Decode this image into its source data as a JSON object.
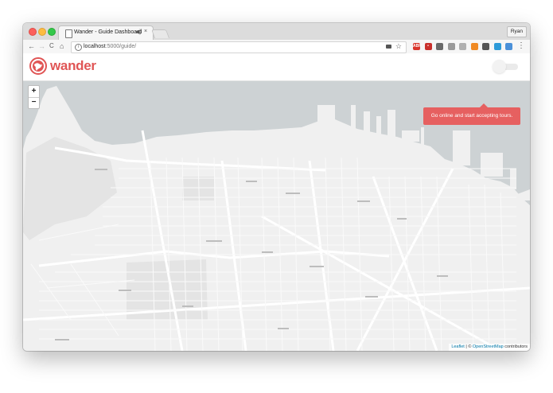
{
  "browser": {
    "tab_title": "Wander - Guide Dashboard",
    "tab_audio_icon": "speaker-icon",
    "tab_close_glyph": "×",
    "profile_name": "Ryan",
    "url_host": "localhost",
    "url_rest": ":5000/guide/",
    "nav": {
      "back": "←",
      "forward": "→",
      "reload": "C",
      "home": "⌂"
    },
    "extensions": [
      {
        "name": "adblock-icon",
        "color": "#d9342b",
        "glyph": "ABP"
      },
      {
        "name": "lastpass-icon",
        "color": "#c9302c",
        "glyph": "•"
      },
      {
        "name": "ghostery-icon",
        "color": "#6a6a6a",
        "glyph": ""
      },
      {
        "name": "camera-icon",
        "color": "#9a9a9a",
        "glyph": ""
      },
      {
        "name": "gray-extension-icon",
        "color": "#b0b0b0",
        "glyph": ""
      },
      {
        "name": "rss-icon",
        "color": "#f08a24",
        "glyph": ""
      },
      {
        "name": "dark-extension-icon",
        "color": "#555555",
        "glyph": ""
      },
      {
        "name": "twitter-icon",
        "color": "#2d9bd9",
        "glyph": ""
      },
      {
        "name": "blue-extension-icon",
        "color": "#4a90d9",
        "glyph": ""
      }
    ]
  },
  "app": {
    "brand": "wander",
    "brand_color": "#e05555",
    "online_toggle_on": false,
    "tooltip": "Go online and start accepting tours.",
    "tooltip_color": "#e66060"
  },
  "map": {
    "zoom_in": "+",
    "zoom_out": "−",
    "attribution": {
      "leaflet": "Leaflet",
      "separator": " | © ",
      "osm": "OpenStreetMap",
      "suffix": " contributors"
    }
  }
}
